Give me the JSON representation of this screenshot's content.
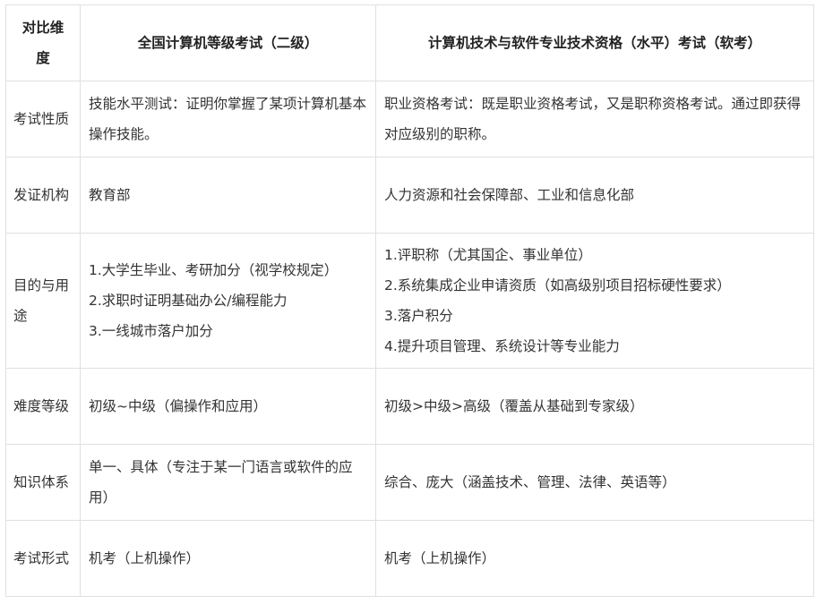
{
  "table": {
    "headers": [
      "对比维度",
      "全国计算机等级考试（二级）",
      "计算机技术与软件专业技术资格（水平）考试（软考）"
    ],
    "rows": [
      {
        "dimension": "考试性质",
        "ncre": "技能水平测试：证明你掌握了某项计算机基本操作技能。",
        "ruankao": "职业资格考试：既是职业资格考试，又是职称资格考试。通过即获得对应级别的职称。"
      },
      {
        "dimension": "发证机构",
        "ncre": "教育部",
        "ruankao": "人力资源和社会保障部、工业和信息化部"
      },
      {
        "dimension": "目的与用途",
        "ncre": [
          "1.大学生毕业、考研加分（视学校规定）",
          "2.求职时证明基础办公/编程能力",
          "3.一线城市落户加分"
        ],
        "ruankao": [
          "1.评职称（尤其国企、事业单位）",
          "2.系统集成企业申请资质（如高级别项目招标硬性要求）",
          "3.落户积分",
          "4.提升项目管理、系统设计等专业能力"
        ]
      },
      {
        "dimension": "难度等级",
        "ncre": "初级~中级（偏操作和应用）",
        "ruankao": "初级>中级>高级（覆盖从基础到专家级）"
      },
      {
        "dimension": "知识体系",
        "ncre": "单一、具体（专注于某一门语言或软件的应用）",
        "ruankao": "综合、庞大（涵盖技术、管理、法律、英语等）"
      },
      {
        "dimension": "考试形式",
        "ncre": "机考（上机操作）",
        "ruankao": "机考（上机操作）"
      }
    ]
  }
}
